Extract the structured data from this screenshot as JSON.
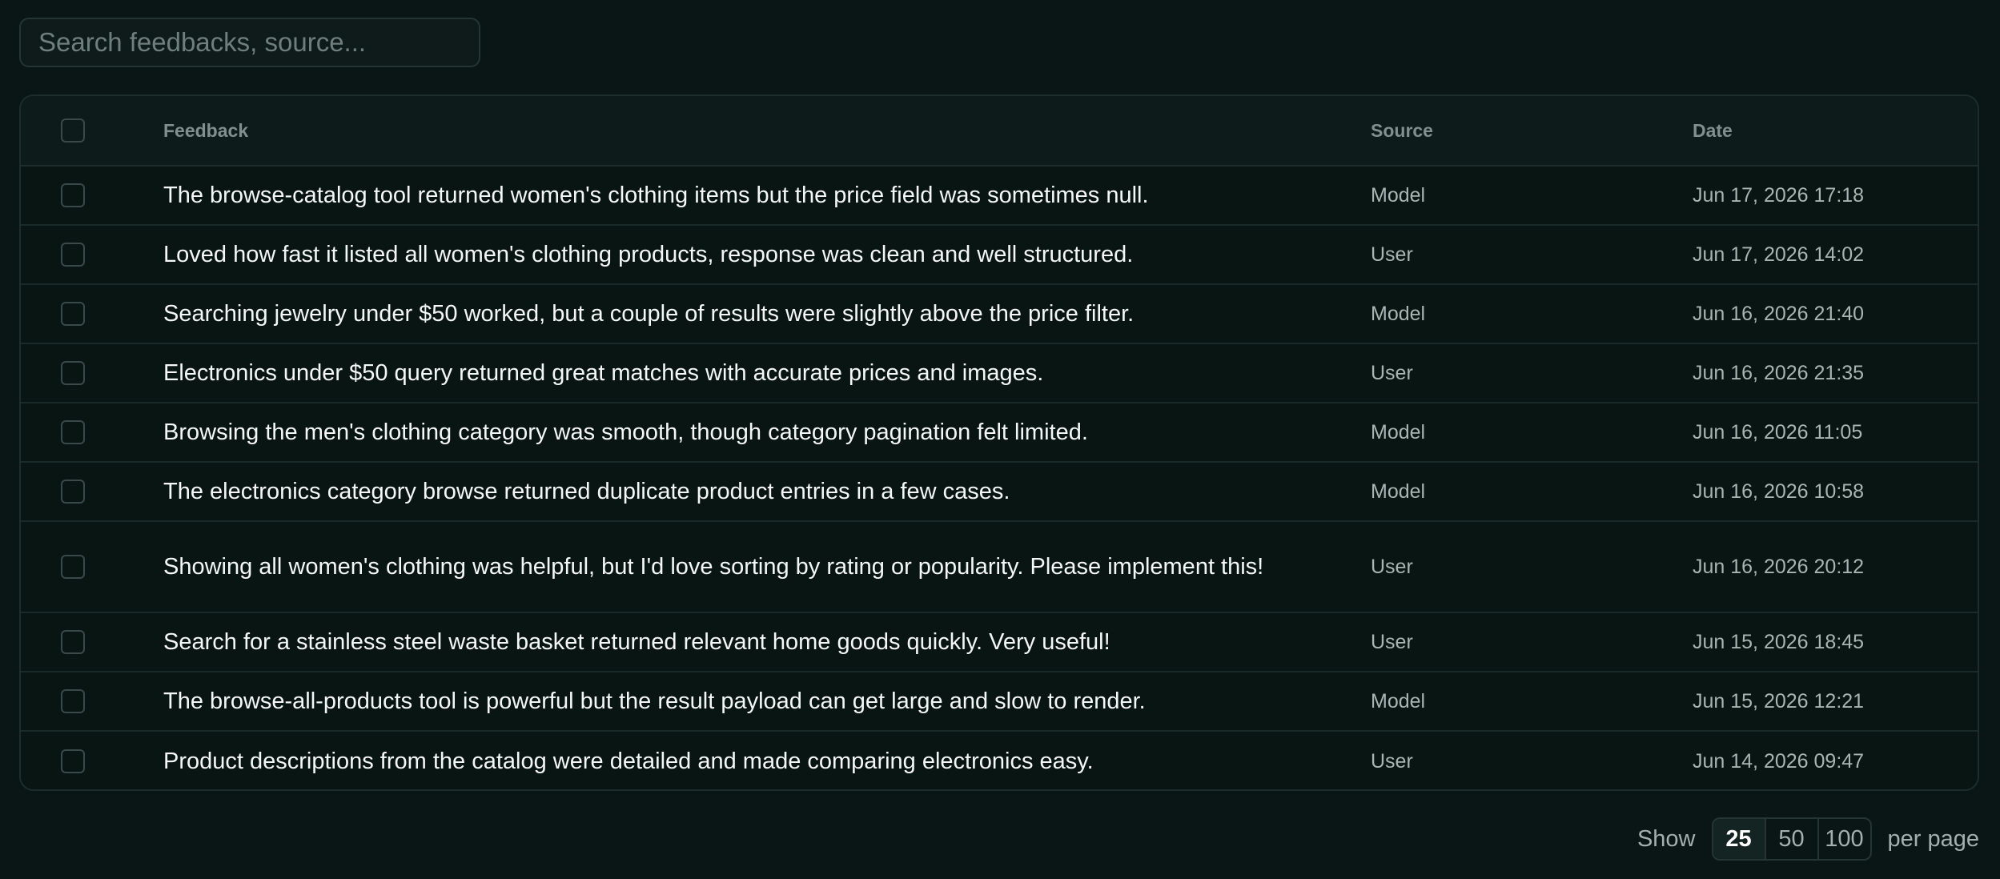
{
  "search": {
    "placeholder": "Search feedbacks, source..."
  },
  "table": {
    "headers": {
      "feedback": "Feedback",
      "source": "Source",
      "date": "Date"
    },
    "rows": [
      {
        "feedback": "The browse-catalog tool returned women's clothing items but the price field was sometimes null.",
        "source": "Model",
        "date": "Jun 17, 2026 17:18"
      },
      {
        "feedback": "Loved how fast it listed all women's clothing products, response was clean and well structured.",
        "source": "User",
        "date": "Jun 17, 2026 14:02"
      },
      {
        "feedback": "Searching jewelry under $50 worked, but a couple of results were slightly above the price filter.",
        "source": "Model",
        "date": "Jun 16, 2026 21:40"
      },
      {
        "feedback": "Electronics under $50 query returned great matches with accurate prices and images.",
        "source": "User",
        "date": "Jun 16, 2026 21:35"
      },
      {
        "feedback": "Browsing the men's clothing category was smooth, though category pagination felt limited.",
        "source": "Model",
        "date": "Jun 16, 2026 11:05"
      },
      {
        "feedback": "The electronics category browse returned duplicate product entries in a few cases.",
        "source": "Model",
        "date": "Jun 16, 2026 10:58"
      },
      {
        "feedback": "Showing all women's clothing was helpful, but I'd love sorting by rating or popularity. Please implement this!",
        "source": "User",
        "date": "Jun 16, 2026 20:12"
      },
      {
        "feedback": "Search for a stainless steel waste basket returned relevant home goods quickly. Very useful!",
        "source": "User",
        "date": "Jun 15, 2026 18:45"
      },
      {
        "feedback": "The browse-all-products tool is powerful but the result payload can get large and slow to render.",
        "source": "Model",
        "date": "Jun 15, 2026 12:21"
      },
      {
        "feedback": "Product descriptions from the catalog were detailed and made comparing electronics easy.",
        "source": "User",
        "date": "Jun 14, 2026 09:47"
      }
    ]
  },
  "pager": {
    "show_label": "Show",
    "options": [
      "25",
      "50",
      "100"
    ],
    "selected": "25",
    "per_page_label": "per page"
  }
}
